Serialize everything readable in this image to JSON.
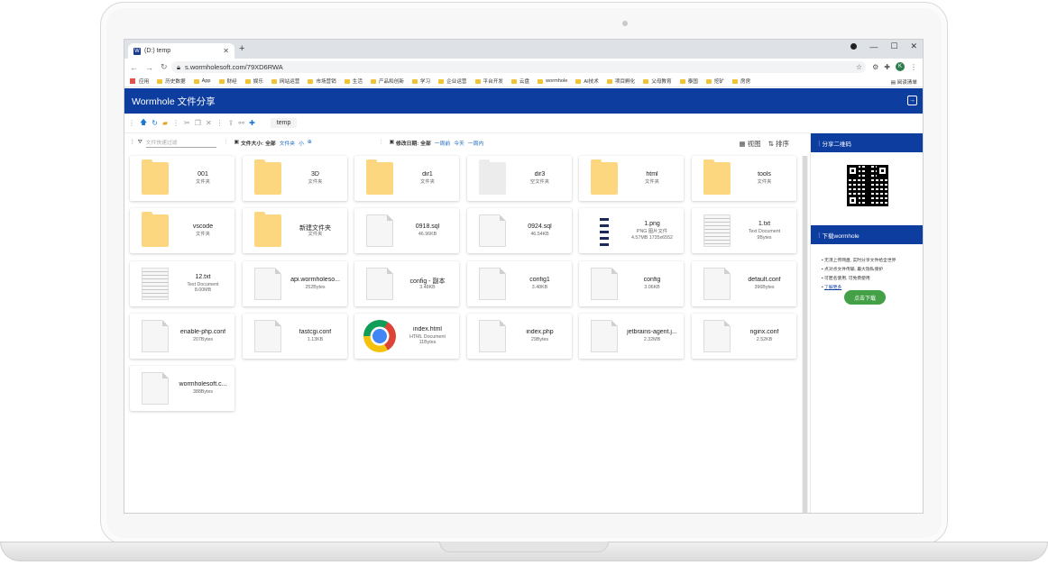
{
  "browser": {
    "tab_title": "(D:) temp",
    "tab_favicon": "W",
    "url": "s.wormholesoft.com/79XD6RWA",
    "profile_initial": "K"
  },
  "bookmarks": {
    "apps": "应用",
    "items": [
      "历史数据",
      "App",
      "财经",
      "娱乐",
      "网站运营",
      "市场营销",
      "生活",
      "产品和创新",
      "学习",
      "企业运营",
      "平台开发",
      "云盘",
      "wormhole",
      "AI技术",
      "项目孵化",
      "父母教育",
      "泰国",
      "挖矿",
      "房房"
    ],
    "reading_list": "阅读清单"
  },
  "app": {
    "title": "Wormhole 文件分享",
    "breadcrumb": "temp"
  },
  "filters": {
    "placeholder": "文件快速过滤",
    "size_label": "文件大小:",
    "size_all": "全部",
    "size_folder": "文件夹",
    "size_small": "小",
    "size_more": "⊕",
    "date_label": "修改日期:",
    "date_all": "全部",
    "date_week": "一周前",
    "date_today": "今天",
    "date_month": "一周内",
    "view_label": "视图",
    "sort_label": "排序"
  },
  "files": [
    {
      "name": "001",
      "meta": "文件夹",
      "kind": "folder"
    },
    {
      "name": "3D",
      "meta": "文件夹",
      "kind": "folder"
    },
    {
      "name": "dir1",
      "meta": "文件夹",
      "kind": "folder"
    },
    {
      "name": "dir3",
      "meta": "空文件夹",
      "kind": "empty-folder"
    },
    {
      "name": "html",
      "meta": "文件夹",
      "kind": "folder"
    },
    {
      "name": "tools",
      "meta": "文件夹",
      "kind": "folder"
    },
    {
      "name": "vscode",
      "meta": "文件夹",
      "kind": "folder"
    },
    {
      "name": "新建文件夹",
      "meta": "文件夹",
      "kind": "folder"
    },
    {
      "name": "0918.sql",
      "meta": "46.96KB",
      "kind": "file"
    },
    {
      "name": "0924.sql",
      "meta": "46.54KB",
      "kind": "file"
    },
    {
      "name": "1.png",
      "meta": "PNG 图片文件\n4.57MB 1735x6552",
      "kind": "png"
    },
    {
      "name": "1.txt",
      "meta": "Text Document\n9Bytes",
      "kind": "text"
    },
    {
      "name": "12.txt",
      "meta": "Text Document\n8.00MB",
      "kind": "text"
    },
    {
      "name": "api.wormholeso...",
      "meta": "252Bytes",
      "kind": "file"
    },
    {
      "name": "config - 副本",
      "meta": "3.48KB",
      "kind": "file"
    },
    {
      "name": "config1",
      "meta": "3.48KB",
      "kind": "file"
    },
    {
      "name": "config",
      "meta": "3.06KB",
      "kind": "file"
    },
    {
      "name": "default.conf",
      "meta": "396Bytes",
      "kind": "file"
    },
    {
      "name": "enable-php.conf",
      "meta": "207Bytes",
      "kind": "file"
    },
    {
      "name": "fastcgi.conf",
      "meta": "1.13KB",
      "kind": "file"
    },
    {
      "name": "index.html",
      "meta": "HTML Document\n11Bytes",
      "kind": "chrome"
    },
    {
      "name": "index.php",
      "meta": "29Bytes",
      "kind": "file"
    },
    {
      "name": "jetbrains-agent.j...",
      "meta": "2.32MB",
      "kind": "file"
    },
    {
      "name": "nginx.conf",
      "meta": "2.52KB",
      "kind": "file"
    },
    {
      "name": "wormholesoft.c...",
      "meta": "388Bytes",
      "kind": "file"
    }
  ],
  "sidebar": {
    "qr_title": "分享二维码",
    "download_title": "下载wormhole",
    "features": [
      "无须上传网盘, 实时分享文件给全世界",
      "点对点文件传输, 最大隐私保护",
      "可匿名使用, 可免费使用"
    ],
    "learn_more": "了解更多",
    "download_button": "点击下载"
  },
  "colors": {
    "header_blue": "#0d3d9f",
    "folder_yellow": "#fcd77f",
    "download_green": "#43a047"
  }
}
